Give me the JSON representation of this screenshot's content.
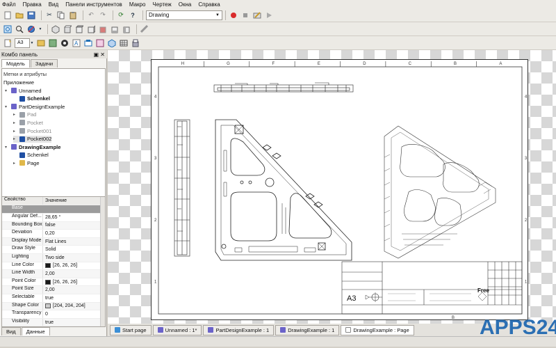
{
  "menu": [
    "Файл",
    "Правка",
    "Вид",
    "Панели инструментов",
    "Макро",
    "Чертеж",
    "Окна",
    "Справка"
  ],
  "toolbar": {
    "workbench": "Drawing",
    "page_size": "A3"
  },
  "panel": {
    "title": "Комбо панель",
    "tabs": [
      "Модель",
      "Задачи"
    ],
    "section_label": "Метки и атрибуты",
    "root_label": "Приложение"
  },
  "tree": [
    {
      "label": "Unnamed",
      "indent": 0,
      "expand": "▾",
      "icon": "doc",
      "bold": false,
      "gray": false
    },
    {
      "label": "Schenkel",
      "indent": 1,
      "expand": "",
      "icon": "part",
      "bold": true,
      "gray": false
    },
    {
      "label": "PartDesignExample",
      "indent": 0,
      "expand": "▾",
      "icon": "doc",
      "bold": false,
      "gray": false
    },
    {
      "label": "Pad",
      "indent": 1,
      "expand": "▸",
      "icon": "feat",
      "bold": false,
      "gray": true
    },
    {
      "label": "Pocket",
      "indent": 1,
      "expand": "▸",
      "icon": "feat",
      "bold": false,
      "gray": true
    },
    {
      "label": "Pocket001",
      "indent": 1,
      "expand": "▸",
      "icon": "feat",
      "bold": false,
      "gray": true
    },
    {
      "label": "Pocket002",
      "indent": 1,
      "expand": "▸",
      "icon": "part",
      "bold": false,
      "gray": false
    },
    {
      "label": "DrawingExample",
      "indent": 0,
      "expand": "▾",
      "icon": "doc",
      "bold": true,
      "gray": false
    },
    {
      "label": "Schenkel",
      "indent": 1,
      "expand": "",
      "icon": "part",
      "bold": false,
      "gray": false
    },
    {
      "label": "Page",
      "indent": 1,
      "expand": "▸",
      "icon": "page",
      "bold": false,
      "gray": false
    }
  ],
  "props": {
    "header_key": "Свойство",
    "header_value": "Значение",
    "group": "Base",
    "rows": [
      {
        "k": "Angular Def...",
        "v": "28,65 °",
        "color": ""
      },
      {
        "k": "Bounding Box",
        "v": "false",
        "color": ""
      },
      {
        "k": "Deviation",
        "v": "0,20",
        "color": ""
      },
      {
        "k": "Display Mode",
        "v": "Flat Lines",
        "color": ""
      },
      {
        "k": "Draw Style",
        "v": "Solid",
        "color": ""
      },
      {
        "k": "Lighting",
        "v": "Two side",
        "color": ""
      },
      {
        "k": "Line Color",
        "v": "[26, 26, 26]",
        "color": "#1a1a1a"
      },
      {
        "k": "Line Width",
        "v": "2,00",
        "color": ""
      },
      {
        "k": "Point Color",
        "v": "[26, 26, 26]",
        "color": "#1a1a1a"
      },
      {
        "k": "Point Size",
        "v": "2,00",
        "color": ""
      },
      {
        "k": "Selectable",
        "v": "true",
        "color": ""
      },
      {
        "k": "Shape Color",
        "v": "[204, 204, 204]",
        "color": "#cccccc"
      },
      {
        "k": "Transparency",
        "v": "0",
        "color": ""
      },
      {
        "k": "Visibility",
        "v": "true",
        "color": ""
      }
    ],
    "bottom_tabs": [
      "Вид",
      "Данные"
    ]
  },
  "sheet": {
    "top_letters": [
      "H",
      "G",
      "F",
      "E",
      "D",
      "C",
      "B",
      "A"
    ],
    "side_numbers": [
      "4",
      "3",
      "2",
      "1"
    ],
    "bottom_letter": "B",
    "title_size": "A3",
    "stamp": "Free"
  },
  "doc_tabs": [
    "Start page",
    "Unnamed : 1*",
    "PartDesignExample : 1",
    "DrawingExample : 1",
    "DrawingExample : Page"
  ],
  "active_doc_tab": 4,
  "watermark": "APPS24",
  "colors": {
    "accent": "#1f6fb6",
    "watermark": "#2b6fb3",
    "record": "#d92b2b"
  }
}
